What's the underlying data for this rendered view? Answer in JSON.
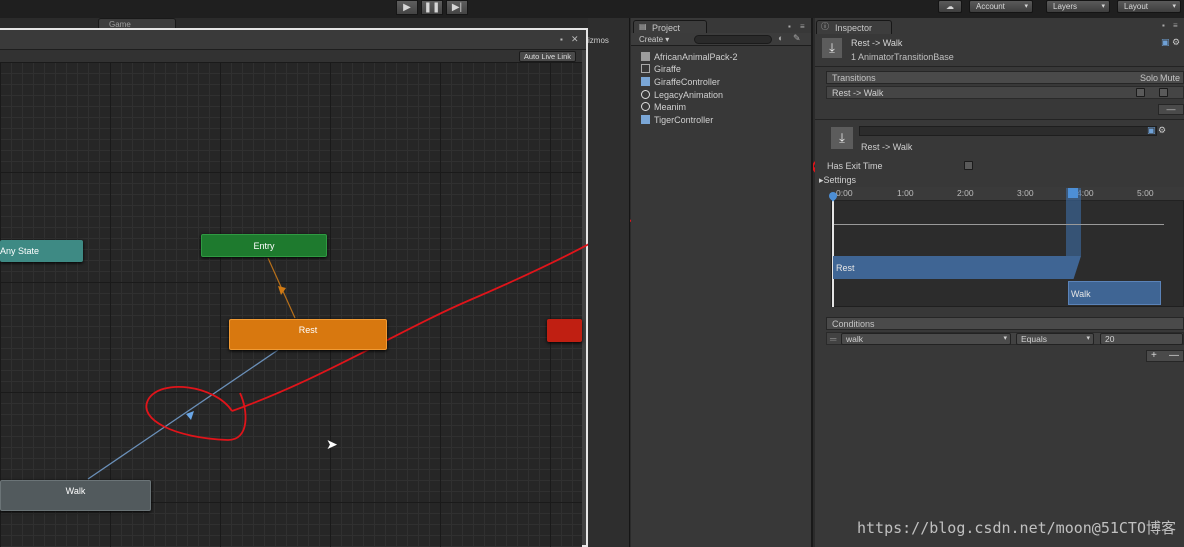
{
  "toolbar": {
    "account_label": "Account",
    "layers_label": "Layers",
    "layout_label": "Layout",
    "play_icon": "play-icon",
    "pause_icon": "pause-icon",
    "step_icon": "step-icon"
  },
  "animator": {
    "game_tab_label": "Game",
    "auto_live_link_label": "Auto Live Link",
    "nodes": {
      "any_state": "Any State",
      "entry": "Entry",
      "rest": "Rest",
      "walk": "Walk"
    },
    "colors": {
      "any_state": "#3e8a84",
      "entry": "#1e7a2e",
      "rest": "#d8780f",
      "walk": "#525a5d",
      "exit": "#c01f12"
    }
  },
  "gizmos": {
    "label": "izmos"
  },
  "project": {
    "tab_label": "Project",
    "create_label": "Create",
    "items": [
      {
        "label": "AfricanAnimalPack-2",
        "icon": "folder-icon"
      },
      {
        "label": "Giraffe",
        "icon": "model-icon"
      },
      {
        "label": "GiraffeController",
        "icon": "animator-controller-icon"
      },
      {
        "label": "LegacyAnimation",
        "icon": "animation-icon"
      },
      {
        "label": "Meanim",
        "icon": "animation-icon"
      },
      {
        "label": "TigerController",
        "icon": "animator-controller-icon"
      }
    ]
  },
  "inspector": {
    "tab_label": "Inspector",
    "title": "Rest -> Walk",
    "subtitle": "1 AnimatorTransitionBase",
    "transitions_header": "Transitions",
    "solo_label": "Solo",
    "mute_label": "Mute",
    "transition_row": "Rest -> Walk",
    "sub_title": "Rest -> Walk",
    "has_exit_time_label": "Has Exit Time",
    "settings_label": "Settings",
    "ruler": [
      "0:00",
      "1:00",
      "2:00",
      "3:00",
      "4:00",
      "5:00"
    ],
    "timeline": {
      "source_label": "Rest",
      "target_label": "Walk"
    },
    "conditions_header": "Conditions",
    "condition": {
      "parameter": "walk",
      "operator": "Equals",
      "value": "20"
    }
  },
  "watermark": "https://blog.csdn.net/moon@51CTO博客"
}
